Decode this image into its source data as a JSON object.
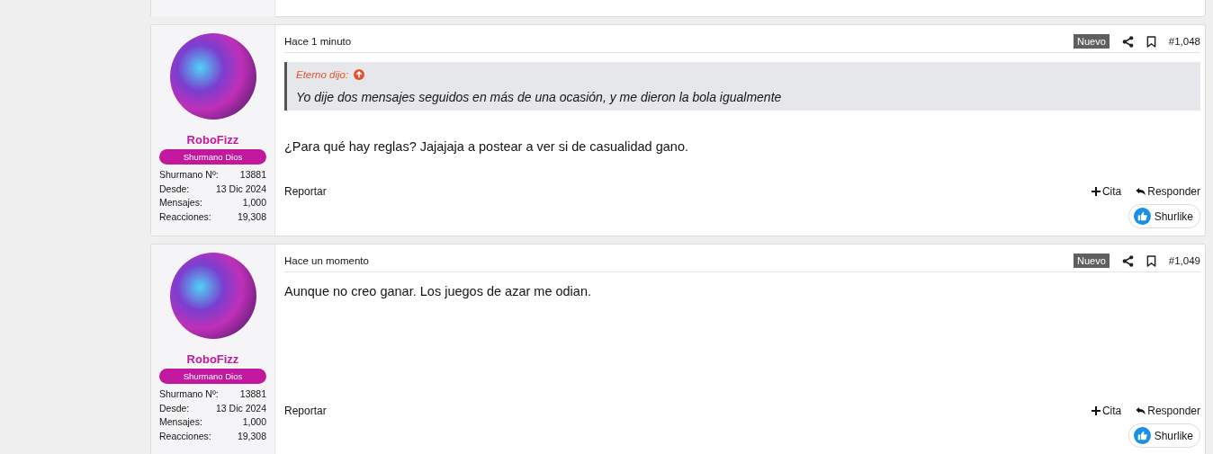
{
  "posts": [
    {
      "author": {
        "name": "RoboFizz",
        "rank": "Shurmano Dios",
        "stats": [
          {
            "label": "Shurmano Nº:",
            "value": "13881"
          },
          {
            "label": "Desde:",
            "value": "13 Dic 2024"
          },
          {
            "label": "Mensajes:",
            "value": "1,000"
          },
          {
            "label": "Reacciones:",
            "value": "19,308"
          }
        ]
      },
      "time": "Hace 1 minuto",
      "is_new": true,
      "new_label": "Nuevo",
      "number": "#1,048",
      "quote": {
        "author": "Eterno dijo:",
        "text": "Yo dije dos mensajes seguidos en más de una ocasión, y me dieron la bola igualmente"
      },
      "body": "¿Para qué hay reglas? Jajajaja a postear a ver si de casualidad gano.",
      "report": "Reportar",
      "quote_button": "Cita",
      "reply_button": "Responder",
      "like_button": "Shurlike"
    },
    {
      "author": {
        "name": "RoboFizz",
        "rank": "Shurmano Dios",
        "stats": [
          {
            "label": "Shurmano Nº:",
            "value": "13881"
          },
          {
            "label": "Desde:",
            "value": "13 Dic 2024"
          },
          {
            "label": "Mensajes:",
            "value": "1,000"
          },
          {
            "label": "Reacciones:",
            "value": "19,308"
          }
        ]
      },
      "time": "Hace un momento",
      "is_new": true,
      "new_label": "Nuevo",
      "number": "#1,049",
      "body": "Aunque no creo ganar. Los juegos de azar me odian.",
      "report": "Reportar",
      "quote_button": "Cita",
      "reply_button": "Responder",
      "like_button": "Shurlike"
    }
  ]
}
